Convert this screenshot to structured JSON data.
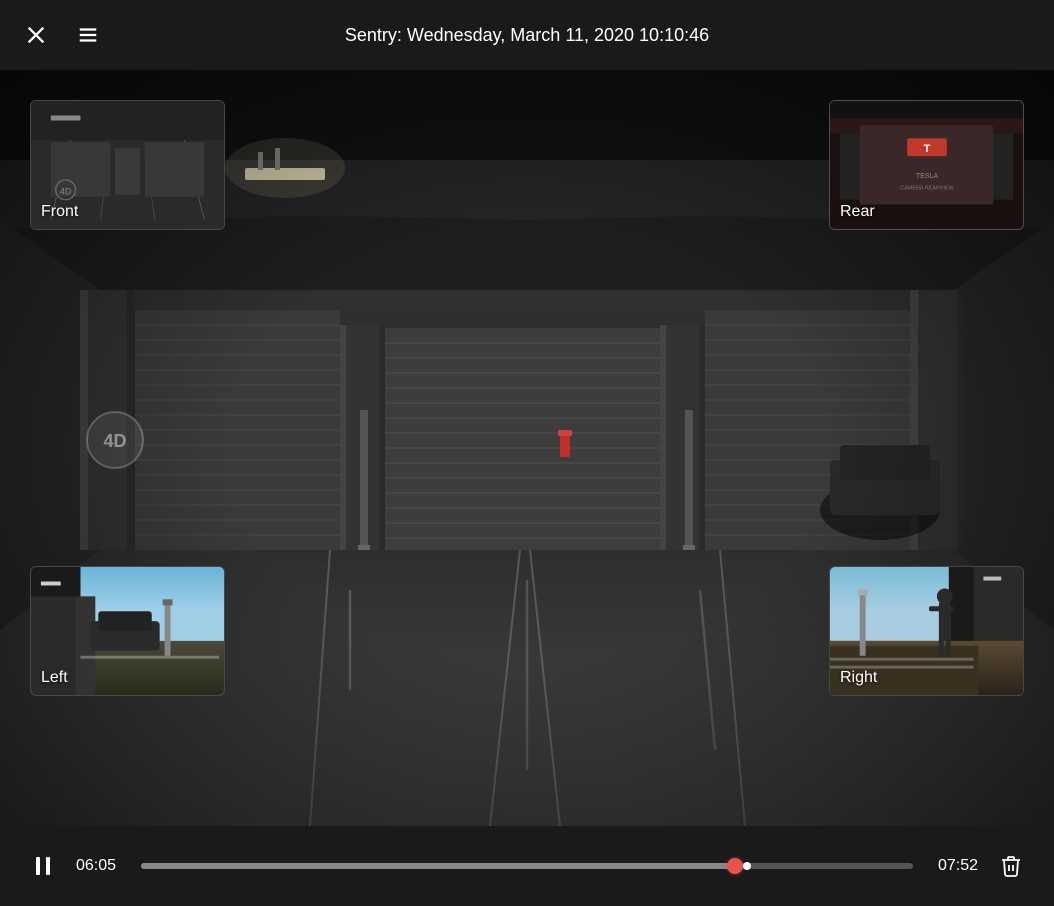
{
  "header": {
    "title": "Sentry: Wednesday, March 11, 2020 10:10:46",
    "close_label": "close",
    "menu_label": "menu"
  },
  "cameras": {
    "front": {
      "label": "Front"
    },
    "rear": {
      "label": "Rear"
    },
    "left": {
      "label": "Left"
    },
    "right": {
      "label": "Right"
    }
  },
  "controls": {
    "current_time": "06:05",
    "total_time": "07:52",
    "progress_percent": 77,
    "pause_label": "pause",
    "delete_label": "delete"
  }
}
